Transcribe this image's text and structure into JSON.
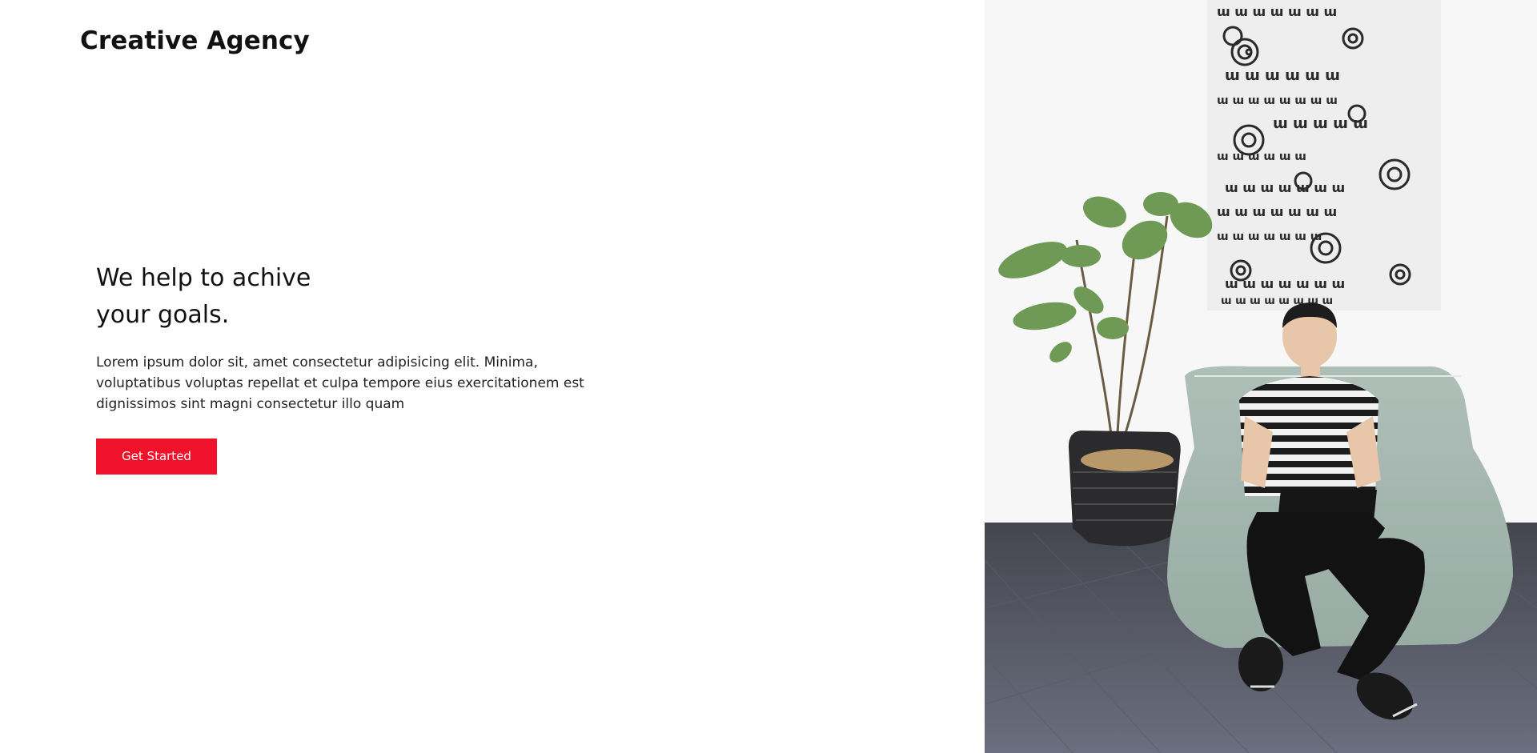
{
  "brand": {
    "name": "Creative Agency"
  },
  "hero": {
    "title": "We help to achive\nyour goals.",
    "text": "Lorem ipsum dolor sit, amet consectetur adipisicing elit. Minima, voluptatibus voluptas repellat et culpa tempore eius exercitationem est dignissimos sint magni consectetur illo quam",
    "cta_label": "Get Started"
  },
  "colors": {
    "accent": "#f0122b",
    "text": "#111111",
    "background": "#ffffff"
  },
  "photo": {
    "subject": "hero-photo"
  }
}
